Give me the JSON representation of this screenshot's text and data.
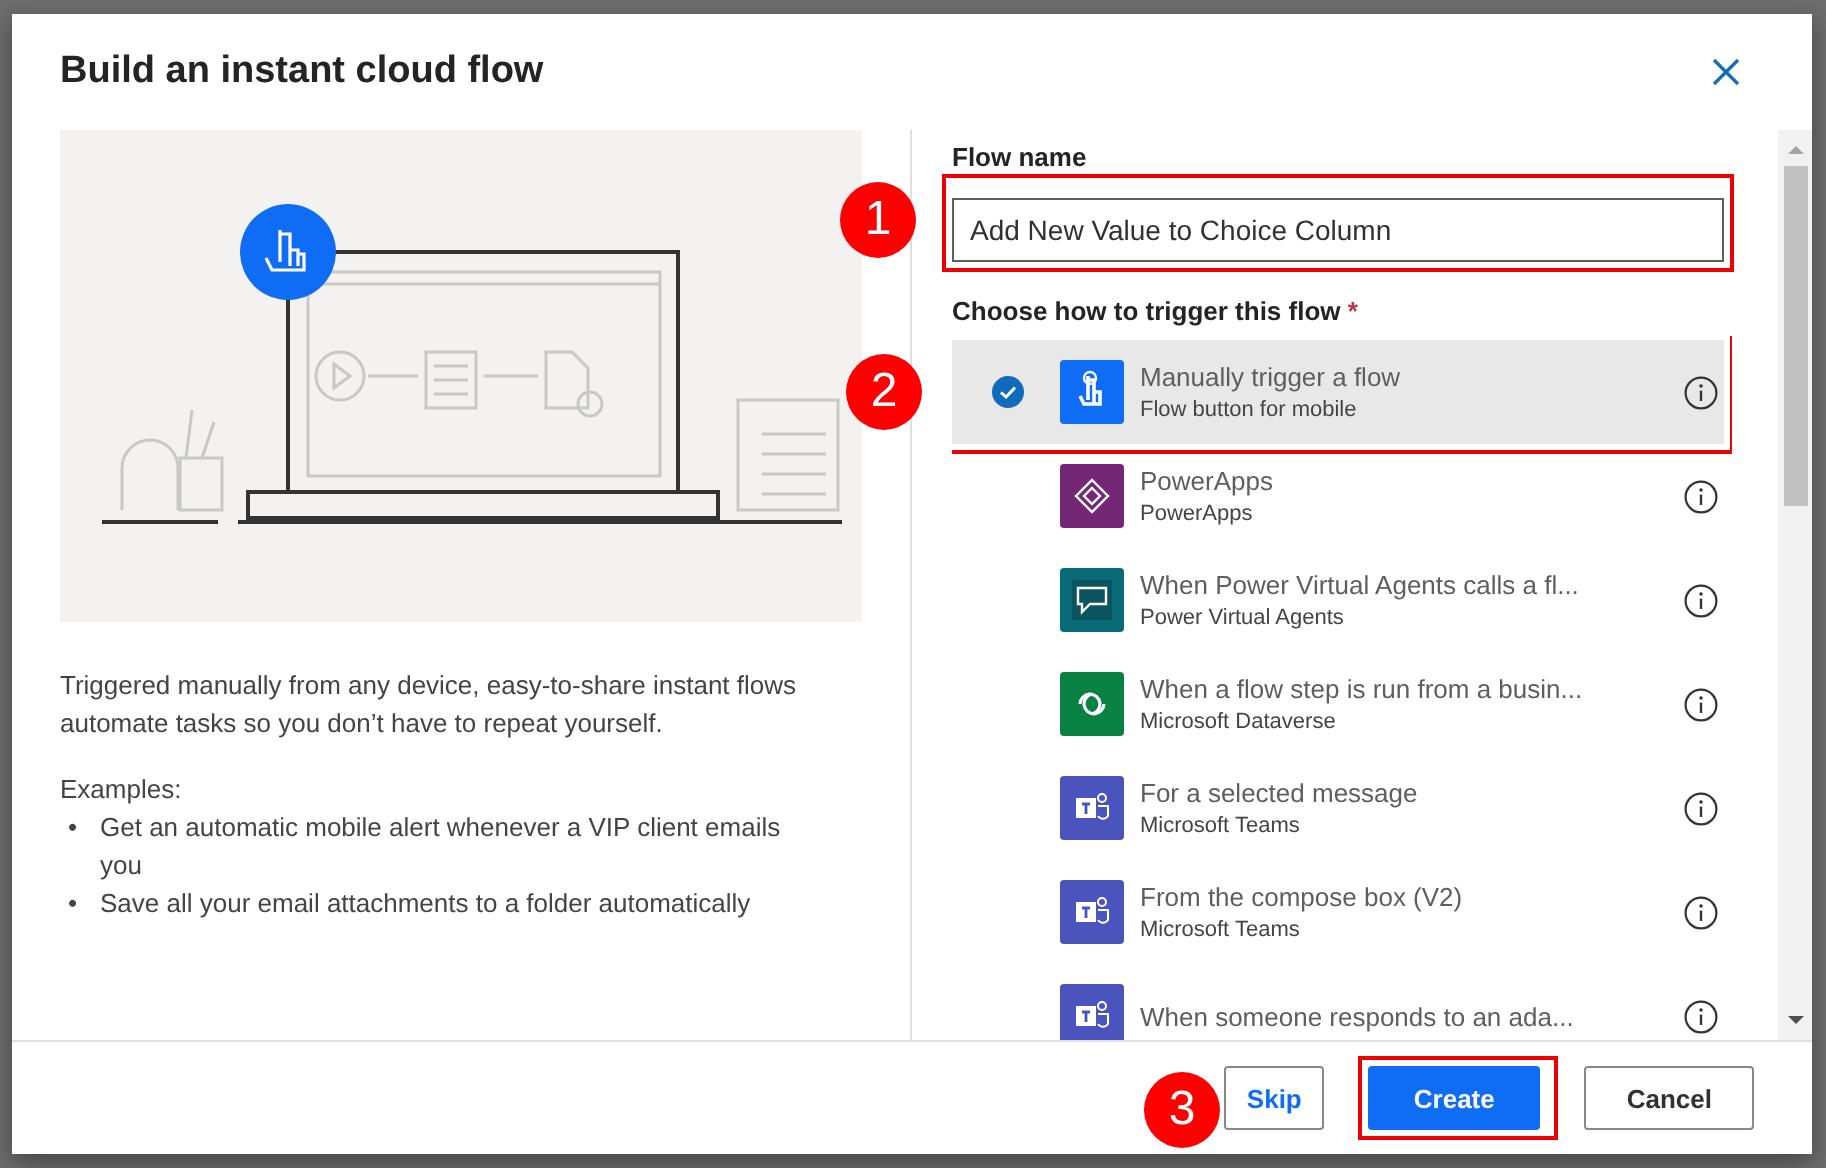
{
  "dialog": {
    "title": "Build an instant cloud flow",
    "description": "Triggered manually from any device, easy-to-share instant flows automate tasks so you don’t have to repeat yourself.",
    "examples_label": "Examples:",
    "examples": [
      {
        "marker": "•",
        "text": "Get an automatic mobile alert whenever a VIP client emails you"
      },
      {
        "marker": "•",
        "text": "Save all your email attachments to a folder automatically"
      }
    ]
  },
  "form": {
    "name_label": "Flow name",
    "name_value": "Add New Value to Choice Column",
    "name_highlighted": true,
    "trigger_label": "Choose how to trigger this flow",
    "required_mark": "*",
    "triggers": [
      {
        "kind": "touch",
        "title": "Manually trigger a flow",
        "subtitle": "Flow button for mobile",
        "color": "#0f6cf5",
        "selected": true,
        "highlighted": true
      },
      {
        "kind": "powerapps",
        "title": "PowerApps",
        "subtitle": "PowerApps",
        "color": "#742774",
        "selected": false,
        "highlighted": false
      },
      {
        "kind": "chat",
        "title": "When Power Virtual Agents calls a fl...",
        "subtitle": "Power Virtual Agents",
        "color": "#0b6a78",
        "selected": false,
        "highlighted": false
      },
      {
        "kind": "dataverse",
        "title": "When a flow step is run from a busin...",
        "subtitle": "Microsoft Dataverse",
        "color": "#088142",
        "selected": false,
        "highlighted": false
      },
      {
        "kind": "teams",
        "title": "For a selected message",
        "subtitle": "Microsoft Teams",
        "color": "#4b53bc",
        "selected": false,
        "highlighted": false
      },
      {
        "kind": "teams",
        "title": "From the compose box (V2)",
        "subtitle": "Microsoft Teams",
        "color": "#4b53bc",
        "selected": false,
        "highlighted": false
      },
      {
        "kind": "teams",
        "title": "When someone responds to an ada...",
        "color": "#4b53bc",
        "selected": false,
        "highlighted": false
      }
    ]
  },
  "buttons": [
    {
      "kind": "link",
      "label": "Skip",
      "highlighted": false
    },
    {
      "kind": "primary",
      "label": "Create",
      "highlighted": true
    },
    {
      "kind": "default",
      "label": "Cancel",
      "highlighted": false
    }
  ],
  "callouts": [
    {
      "number": "1"
    },
    {
      "number": "2"
    },
    {
      "number": "3"
    }
  ]
}
